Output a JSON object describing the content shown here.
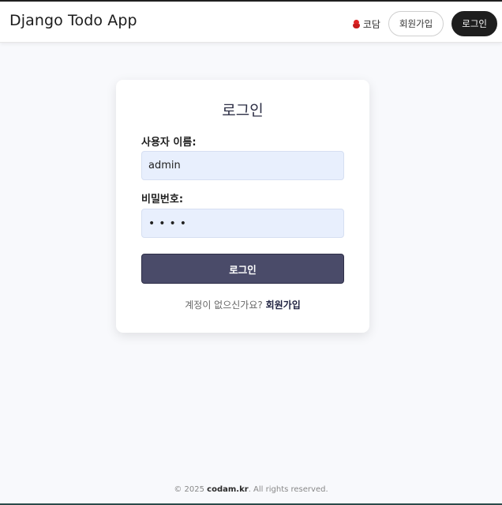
{
  "navbar": {
    "brand": "Django Todo App",
    "codam_label": "코담",
    "signup_label": "회원가입",
    "login_label": "로그인"
  },
  "login_card": {
    "title": "로그인",
    "username_label": "사용자 이름:",
    "username_value": "admin",
    "password_label": "비밀번호:",
    "password_value": "••••",
    "submit_label": "로그인",
    "no_account_text": "계정이 없으신가요?",
    "signup_link": "회원가입"
  },
  "footer": {
    "prefix": "© 2025",
    "site": "codam.kr",
    "suffix": ". All rights reserved."
  },
  "colors": {
    "submit_bg": "#4a4b69",
    "input_bg": "#e8effd",
    "dark_button": "#1e1e1e",
    "codam_icon": "#e02424"
  }
}
